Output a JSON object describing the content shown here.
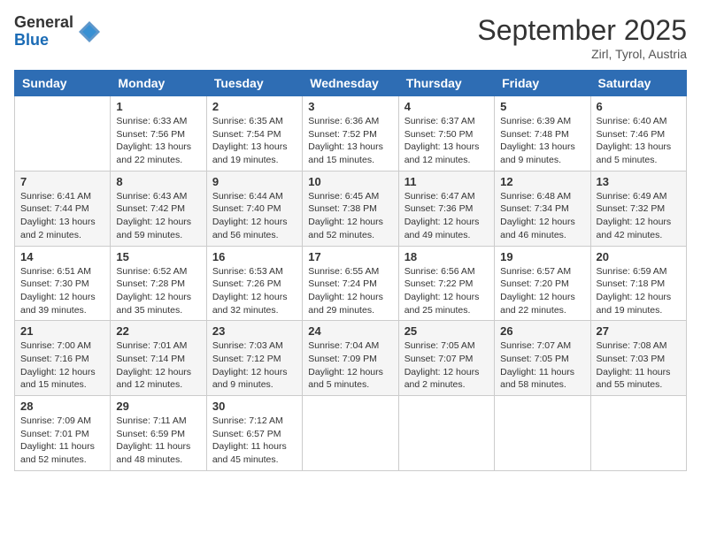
{
  "logo": {
    "general": "General",
    "blue": "Blue"
  },
  "title": "September 2025",
  "subtitle": "Zirl, Tyrol, Austria",
  "days_of_week": [
    "Sunday",
    "Monday",
    "Tuesday",
    "Wednesday",
    "Thursday",
    "Friday",
    "Saturday"
  ],
  "weeks": [
    [
      {
        "day": "",
        "sunrise": "",
        "sunset": "",
        "daylight": ""
      },
      {
        "day": "1",
        "sunrise": "Sunrise: 6:33 AM",
        "sunset": "Sunset: 7:56 PM",
        "daylight": "Daylight: 13 hours and 22 minutes."
      },
      {
        "day": "2",
        "sunrise": "Sunrise: 6:35 AM",
        "sunset": "Sunset: 7:54 PM",
        "daylight": "Daylight: 13 hours and 19 minutes."
      },
      {
        "day": "3",
        "sunrise": "Sunrise: 6:36 AM",
        "sunset": "Sunset: 7:52 PM",
        "daylight": "Daylight: 13 hours and 15 minutes."
      },
      {
        "day": "4",
        "sunrise": "Sunrise: 6:37 AM",
        "sunset": "Sunset: 7:50 PM",
        "daylight": "Daylight: 13 hours and 12 minutes."
      },
      {
        "day": "5",
        "sunrise": "Sunrise: 6:39 AM",
        "sunset": "Sunset: 7:48 PM",
        "daylight": "Daylight: 13 hours and 9 minutes."
      },
      {
        "day": "6",
        "sunrise": "Sunrise: 6:40 AM",
        "sunset": "Sunset: 7:46 PM",
        "daylight": "Daylight: 13 hours and 5 minutes."
      }
    ],
    [
      {
        "day": "7",
        "sunrise": "Sunrise: 6:41 AM",
        "sunset": "Sunset: 7:44 PM",
        "daylight": "Daylight: 13 hours and 2 minutes."
      },
      {
        "day": "8",
        "sunrise": "Sunrise: 6:43 AM",
        "sunset": "Sunset: 7:42 PM",
        "daylight": "Daylight: 12 hours and 59 minutes."
      },
      {
        "day": "9",
        "sunrise": "Sunrise: 6:44 AM",
        "sunset": "Sunset: 7:40 PM",
        "daylight": "Daylight: 12 hours and 56 minutes."
      },
      {
        "day": "10",
        "sunrise": "Sunrise: 6:45 AM",
        "sunset": "Sunset: 7:38 PM",
        "daylight": "Daylight: 12 hours and 52 minutes."
      },
      {
        "day": "11",
        "sunrise": "Sunrise: 6:47 AM",
        "sunset": "Sunset: 7:36 PM",
        "daylight": "Daylight: 12 hours and 49 minutes."
      },
      {
        "day": "12",
        "sunrise": "Sunrise: 6:48 AM",
        "sunset": "Sunset: 7:34 PM",
        "daylight": "Daylight: 12 hours and 46 minutes."
      },
      {
        "day": "13",
        "sunrise": "Sunrise: 6:49 AM",
        "sunset": "Sunset: 7:32 PM",
        "daylight": "Daylight: 12 hours and 42 minutes."
      }
    ],
    [
      {
        "day": "14",
        "sunrise": "Sunrise: 6:51 AM",
        "sunset": "Sunset: 7:30 PM",
        "daylight": "Daylight: 12 hours and 39 minutes."
      },
      {
        "day": "15",
        "sunrise": "Sunrise: 6:52 AM",
        "sunset": "Sunset: 7:28 PM",
        "daylight": "Daylight: 12 hours and 35 minutes."
      },
      {
        "day": "16",
        "sunrise": "Sunrise: 6:53 AM",
        "sunset": "Sunset: 7:26 PM",
        "daylight": "Daylight: 12 hours and 32 minutes."
      },
      {
        "day": "17",
        "sunrise": "Sunrise: 6:55 AM",
        "sunset": "Sunset: 7:24 PM",
        "daylight": "Daylight: 12 hours and 29 minutes."
      },
      {
        "day": "18",
        "sunrise": "Sunrise: 6:56 AM",
        "sunset": "Sunset: 7:22 PM",
        "daylight": "Daylight: 12 hours and 25 minutes."
      },
      {
        "day": "19",
        "sunrise": "Sunrise: 6:57 AM",
        "sunset": "Sunset: 7:20 PM",
        "daylight": "Daylight: 12 hours and 22 minutes."
      },
      {
        "day": "20",
        "sunrise": "Sunrise: 6:59 AM",
        "sunset": "Sunset: 7:18 PM",
        "daylight": "Daylight: 12 hours and 19 minutes."
      }
    ],
    [
      {
        "day": "21",
        "sunrise": "Sunrise: 7:00 AM",
        "sunset": "Sunset: 7:16 PM",
        "daylight": "Daylight: 12 hours and 15 minutes."
      },
      {
        "day": "22",
        "sunrise": "Sunrise: 7:01 AM",
        "sunset": "Sunset: 7:14 PM",
        "daylight": "Daylight: 12 hours and 12 minutes."
      },
      {
        "day": "23",
        "sunrise": "Sunrise: 7:03 AM",
        "sunset": "Sunset: 7:12 PM",
        "daylight": "Daylight: 12 hours and 9 minutes."
      },
      {
        "day": "24",
        "sunrise": "Sunrise: 7:04 AM",
        "sunset": "Sunset: 7:09 PM",
        "daylight": "Daylight: 12 hours and 5 minutes."
      },
      {
        "day": "25",
        "sunrise": "Sunrise: 7:05 AM",
        "sunset": "Sunset: 7:07 PM",
        "daylight": "Daylight: 12 hours and 2 minutes."
      },
      {
        "day": "26",
        "sunrise": "Sunrise: 7:07 AM",
        "sunset": "Sunset: 7:05 PM",
        "daylight": "Daylight: 11 hours and 58 minutes."
      },
      {
        "day": "27",
        "sunrise": "Sunrise: 7:08 AM",
        "sunset": "Sunset: 7:03 PM",
        "daylight": "Daylight: 11 hours and 55 minutes."
      }
    ],
    [
      {
        "day": "28",
        "sunrise": "Sunrise: 7:09 AM",
        "sunset": "Sunset: 7:01 PM",
        "daylight": "Daylight: 11 hours and 52 minutes."
      },
      {
        "day": "29",
        "sunrise": "Sunrise: 7:11 AM",
        "sunset": "Sunset: 6:59 PM",
        "daylight": "Daylight: 11 hours and 48 minutes."
      },
      {
        "day": "30",
        "sunrise": "Sunrise: 7:12 AM",
        "sunset": "Sunset: 6:57 PM",
        "daylight": "Daylight: 11 hours and 45 minutes."
      },
      {
        "day": "",
        "sunrise": "",
        "sunset": "",
        "daylight": ""
      },
      {
        "day": "",
        "sunrise": "",
        "sunset": "",
        "daylight": ""
      },
      {
        "day": "",
        "sunrise": "",
        "sunset": "",
        "daylight": ""
      },
      {
        "day": "",
        "sunrise": "",
        "sunset": "",
        "daylight": ""
      }
    ]
  ]
}
